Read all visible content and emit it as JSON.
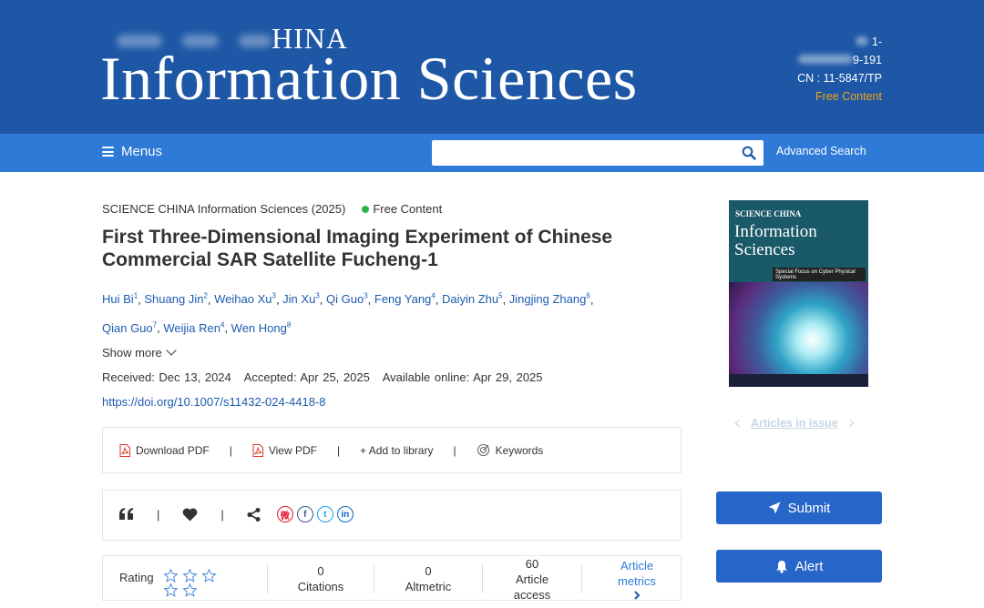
{
  "header": {
    "brand_top": "HINA",
    "brand_main": "Information Sciences",
    "issn_line_1": "1-",
    "issn_line_2": "9-191",
    "cn": "CN : 11-5847/TP",
    "free_content": "Free Content"
  },
  "nav": {
    "menus_label": "Menus",
    "search_placeholder": "",
    "advanced_search": "Advanced Search"
  },
  "article": {
    "journal": "SCIENCE CHINA Information Sciences (2025)",
    "access_badge": "Free Content",
    "title": "First Three-Dimensional Imaging Experiment of Chinese Commercial SAR Satellite Fucheng-1",
    "authors": [
      {
        "name": "Hui Bi",
        "aff": "1"
      },
      {
        "name": "Shuang Jin",
        "aff": "2"
      },
      {
        "name": "Weihao Xu",
        "aff": "3"
      },
      {
        "name": "Jin Xu",
        "aff": "3"
      },
      {
        "name": "Qi Guo",
        "aff": "3"
      },
      {
        "name": "Feng Yang",
        "aff": "4"
      },
      {
        "name": "Daiyin Zhu",
        "aff": "5"
      },
      {
        "name": "Jingjing Zhang",
        "aff": "6"
      },
      {
        "name": "Qian Guo",
        "aff": "7"
      },
      {
        "name": "Weijia Ren",
        "aff": "4"
      },
      {
        "name": "Wen Hong",
        "aff": "8"
      }
    ],
    "show_more": "Show more",
    "received": "Received: Dec 13, 2024",
    "accepted": "Accepted: Apr 25, 2025",
    "available": "Available online: Apr 29, 2025",
    "doi": "https://doi.org/10.1007/s11432-024-4418-8"
  },
  "actions": {
    "download_pdf": "Download PDF",
    "view_pdf": "View PDF",
    "add_library": "+ Add to library",
    "keywords": "Keywords",
    "separator": "|"
  },
  "share": {
    "social": [
      {
        "icon": "weibo-icon",
        "glyph": "微",
        "color": "#e6162d"
      },
      {
        "icon": "facebook-icon",
        "glyph": "f",
        "color": "#3b5998"
      },
      {
        "icon": "twitter-icon",
        "glyph": "t",
        "color": "#1da1f2"
      },
      {
        "icon": "linkedin-icon",
        "glyph": "in",
        "color": "#0a66c2"
      }
    ]
  },
  "metrics": {
    "rating_label": "Rating",
    "stars": 5,
    "rating_value": 0,
    "citations_value": "0",
    "citations_label": "Citations",
    "altmetric_value": "0",
    "altmetric_label": "Altmetric",
    "access_value": "60",
    "access_label_1": "Article",
    "access_label_2": "access",
    "article_metrics_1": "Article",
    "article_metrics_2": "metrics"
  },
  "sidebar": {
    "cover_brand": "SCIENCE CHINA",
    "cover_title_1": "Information",
    "cover_title_2": "Sciences",
    "cover_bar": "Special Focus on Cyber Physical Systems",
    "articles_in_issue": "Articles in issue",
    "submit": "Submit",
    "alert": "Alert"
  },
  "colors": {
    "masthead": "#1d57a6",
    "navbar": "#2e7ad6",
    "link": "#1c5bb0",
    "accent_orange": "#f4a41a",
    "button": "#2766c9",
    "badge_green": "#2cb34a"
  }
}
